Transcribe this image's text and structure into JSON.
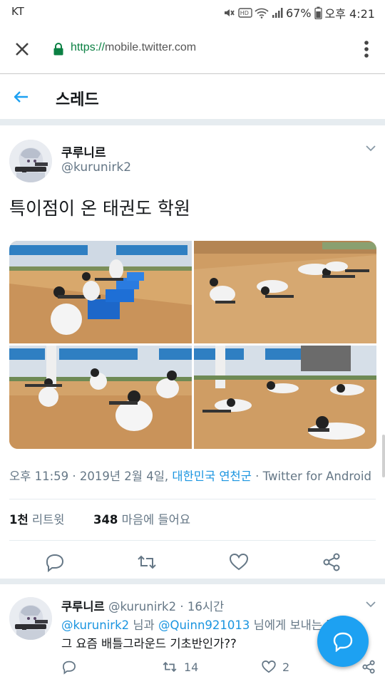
{
  "status_bar": {
    "carrier": "KT",
    "battery": "67%",
    "time": "오후 4:21",
    "hd_label": "HD",
    "icons": [
      "mute-icon",
      "hd-voice-icon",
      "wifi-icon",
      "signal-icon",
      "battery-icon"
    ]
  },
  "browser": {
    "url_scheme": "https://",
    "url_host": "mobile.twitter.com",
    "icons": [
      "close-icon",
      "lock-icon",
      "more-vert-icon"
    ]
  },
  "header": {
    "title": "스레드",
    "back_icon": "arrow-left-icon"
  },
  "tweet": {
    "display_name": "쿠루니르",
    "handle": "@kurunirk2",
    "text": "특이점이 온 태권도 학원",
    "media_count": 4,
    "time": "오후 11:59 · 2019년 2월 4일, ",
    "place": "대한민국 연천군",
    "source": " · Twitter for Android",
    "retweets_count": "1천",
    "retweets_label": "리트윗",
    "likes_count": "348",
    "likes_label": "마음에 들어요",
    "actions": [
      "reply-icon",
      "retweet-icon",
      "like-icon",
      "share-icon"
    ]
  },
  "reply": {
    "display_name": "쿠루니르",
    "handle": "@kurunirk2",
    "time": "· 16시간",
    "to_mention1": "@kurunirk2",
    "to_text1": " 님과 ",
    "to_mention2": "@Quinn921013",
    "to_text2": " 님에게 보내는 답",
    "text": "그 요즘 배틀그라운드 기초반인가??",
    "retweets": "14",
    "likes": "2"
  },
  "colors": {
    "twitter_blue": "#1da1f2",
    "link_blue": "#1b95e0",
    "secondary_text": "#657786",
    "https_green": "#0b8043"
  }
}
